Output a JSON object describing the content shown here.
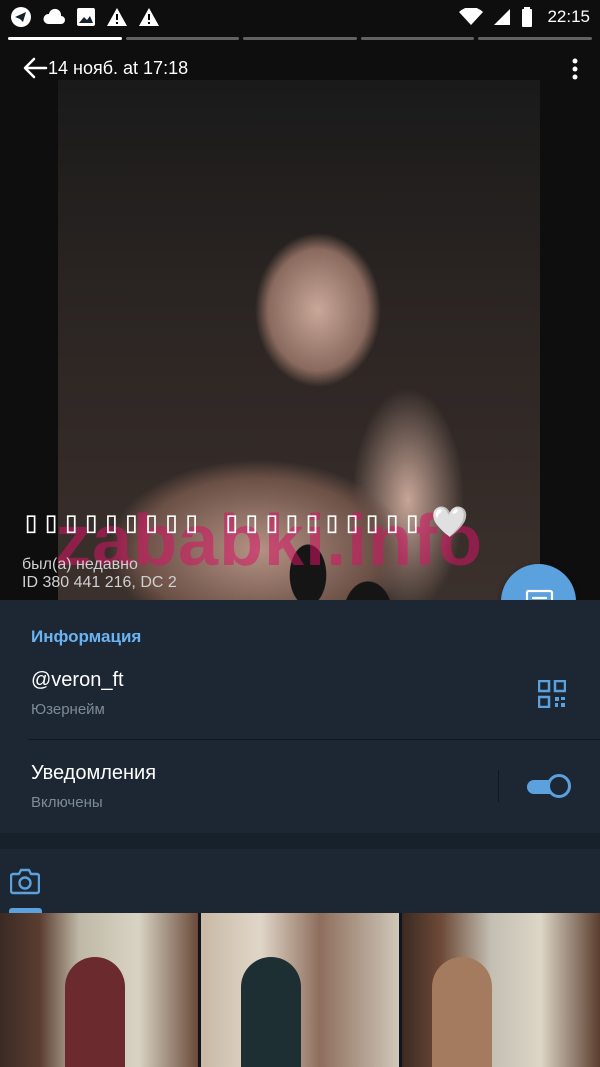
{
  "status_bar": {
    "time": "22:15"
  },
  "header": {
    "date": "14 нояб. at 17:18",
    "name": "▯▯▯▯▯▯▯▯▯ ▯▯▯▯▯▯▯▯▯▯",
    "heart": "🤍",
    "last_seen": "был(а) недавно",
    "id": "ID 380 441 216, DC 2",
    "watermark": "zababki.info"
  },
  "info": {
    "section_title": "Информация",
    "username": "@veron_ft",
    "username_caption": "Юзернейм",
    "notifications_label": "Уведомления",
    "notifications_caption": "Включены",
    "notifications_on": true
  },
  "colors": {
    "accent": "#5aa1dd",
    "section_bg": "#1d2733",
    "page_bg": "#17212b",
    "title_blue": "#6ab3f3"
  },
  "icons": [
    "telegram-icon",
    "cloud-icon",
    "image-icon",
    "warning-icon",
    "wifi-icon",
    "signal-icon",
    "battery-icon",
    "back-arrow-icon",
    "more-vert-icon",
    "message-icon",
    "qr-code-icon",
    "camera-icon"
  ]
}
